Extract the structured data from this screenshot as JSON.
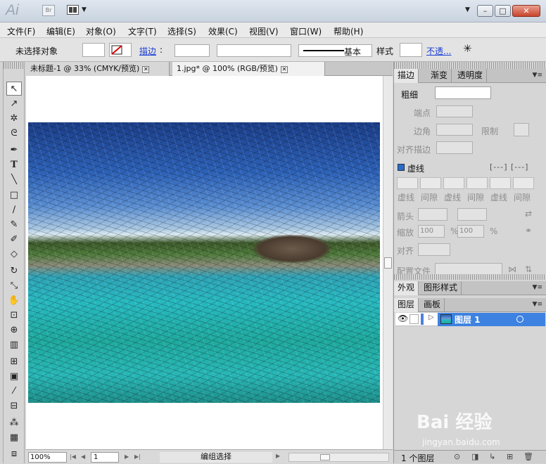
{
  "app": {
    "logo": "Ai",
    "bridge_label": "Br"
  },
  "window_controls": {
    "minimize": "–",
    "maximize": "□",
    "close": "✕"
  },
  "menu": [
    "文件(F)",
    "编辑(E)",
    "对象(O)",
    "文字(T)",
    "选择(S)",
    "效果(C)",
    "视图(V)",
    "窗口(W)",
    "帮助(H)"
  ],
  "control": {
    "no_selection": "未选择对象",
    "stroke_label": "描边",
    "stroke_profile": "基本",
    "style_label": "样式",
    "opacity_label": "不透..."
  },
  "tabs": [
    {
      "label": "未标题-1 @ 33% (CMYK/预览)"
    },
    {
      "label": "1.jpg* @ 100% (RGB/预览)"
    }
  ],
  "status": {
    "zoom": "100%",
    "page": "1",
    "text": "编组选择"
  },
  "stroke_panel": {
    "tabs": [
      "描边",
      "渐变",
      "透明度"
    ],
    "weight_label": "粗细",
    "cap_label": "端点",
    "corner_label": "边角",
    "limit_label": "限制",
    "align_label": "对齐描边",
    "dashed_label": "虚线",
    "dash_labels": [
      "虚线",
      "间隙",
      "虚线",
      "间隙",
      "虚线",
      "间隙"
    ],
    "arrow_label": "箭头",
    "scale_label": "缩放",
    "scale_values": [
      "100",
      "100"
    ],
    "percent": "%",
    "align2_label": "对齐",
    "profile_label": "配置文件"
  },
  "appearance_panel": {
    "tabs": [
      "外观",
      "图形样式"
    ]
  },
  "layers_panel": {
    "tabs": [
      "图层",
      "画板"
    ],
    "layer_name": "图层 1",
    "count": "1 个图层"
  },
  "watermark": {
    "main": "Bai 经验",
    "sub": "jingyan.baidu.com"
  }
}
